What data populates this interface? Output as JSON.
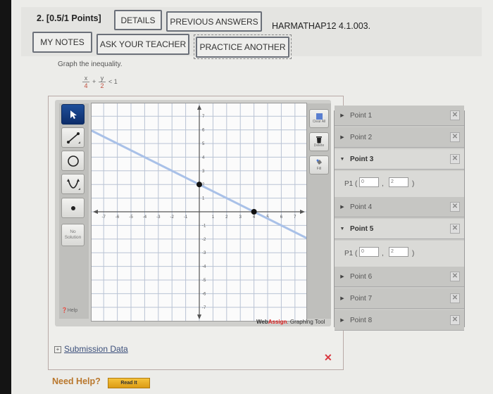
{
  "header": {
    "question_number": "2.",
    "points": "[0.5/1 Points]",
    "buttons": {
      "details": "DETAILS",
      "previous_answers": "PREVIOUS ANSWERS",
      "my_notes": "MY NOTES",
      "ask_teacher": "ASK YOUR TEACHER",
      "practice_another": "PRACTICE ANOTHER"
    },
    "problem_code": "HARMATHAP12 4.1.003."
  },
  "question": {
    "prompt": "Graph the inequality.",
    "inequality": {
      "term1_num": "x",
      "term1_den": "4",
      "op1": "+",
      "term2_num": "y",
      "term2_den": "2",
      "relation": "< 1"
    }
  },
  "graph_tool": {
    "left_tools": [
      {
        "name": "select",
        "icon": "cursor-arrow-icon",
        "active": true
      },
      {
        "name": "line",
        "icon": "line-tool-icon"
      },
      {
        "name": "circle",
        "icon": "circle-tool-icon"
      },
      {
        "name": "parabola",
        "icon": "parabola-tool-icon"
      },
      {
        "name": "point",
        "icon": "point-tool-icon"
      }
    ],
    "no_solution_line1": "No",
    "no_solution_line2": "Solution",
    "help_label": "Help",
    "right_tools": {
      "clear_all": "Clear All",
      "delete": "Delete",
      "fill": "Fill"
    },
    "brand_web": "Web",
    "brand_assign": "Assign",
    "brand_rest": ". Graphing Tool",
    "colors": {
      "line": "#a9c1e8",
      "point": "#111111",
      "active_tool": "#1f4f9a"
    }
  },
  "chart_data": {
    "type": "line",
    "title": "",
    "xlabel": "",
    "ylabel": "",
    "xlim": [
      -7.7,
      7.7
    ],
    "ylim": [
      -7.7,
      7.7
    ],
    "grid": true,
    "x_ticks": [
      -7,
      -6,
      -5,
      -4,
      -3,
      -2,
      -1,
      1,
      2,
      3,
      4,
      5,
      6,
      7
    ],
    "y_ticks": [
      -7,
      -6,
      -5,
      -4,
      -3,
      -2,
      -1,
      1,
      2,
      3,
      4,
      5,
      6,
      7
    ],
    "series": [
      {
        "name": "boundary-line",
        "points": [
          [
            0,
            2
          ],
          [
            4,
            0
          ]
        ],
        "style": "solid"
      }
    ],
    "plotted_points": [
      [
        0,
        2
      ],
      [
        4,
        0
      ]
    ]
  },
  "points_panel": {
    "items": [
      {
        "label": "Point 1",
        "open": false
      },
      {
        "label": "Point 2",
        "open": false
      },
      {
        "label": "Point 3",
        "open": true,
        "p1_label": "P1 (",
        "x": "0",
        "y": "2"
      },
      {
        "label": "Point 4",
        "open": false
      },
      {
        "label": "Point 5",
        "open": true,
        "p1_label": "P1 (",
        "x": "0",
        "y": "2"
      },
      {
        "label": "Point 6",
        "open": false
      },
      {
        "label": "Point 7",
        "open": false
      },
      {
        "label": "Point 8",
        "open": false
      }
    ],
    "comma": ",",
    "close_paren": ")"
  },
  "footer": {
    "submission_data": "Submission Data",
    "expand_symbol": "+",
    "incorrect_mark": "✕",
    "need_help": "Need Help?",
    "read_it": "Read It"
  }
}
